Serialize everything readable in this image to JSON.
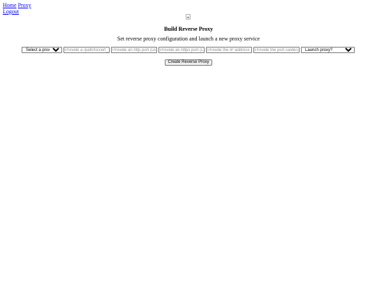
{
  "nav": {
    "home": "Home",
    "proxy": "Proxy",
    "logout": "Logout"
  },
  "page": {
    "title": "Build Reverse Proxy",
    "subtitle": "Set reverse proxy configuration and launch a new proxy service"
  },
  "form": {
    "proxy_type": {
      "selected": "Select a proxy type"
    },
    "cert_path": {
      "placeholder": "Provide a /path/to/cert_key"
    },
    "http_port": {
      "placeholder": "Provide an http port (Default)"
    },
    "https_port": {
      "placeholder": "Provide an https port (Default)"
    },
    "ip_address": {
      "placeholder": "Provide the IP address of"
    },
    "caldera_port": {
      "placeholder": "Provide the port caldera c"
    },
    "launch": {
      "selected": "Launch proxy?"
    },
    "submit_label": "Create Reverse Proxy"
  }
}
